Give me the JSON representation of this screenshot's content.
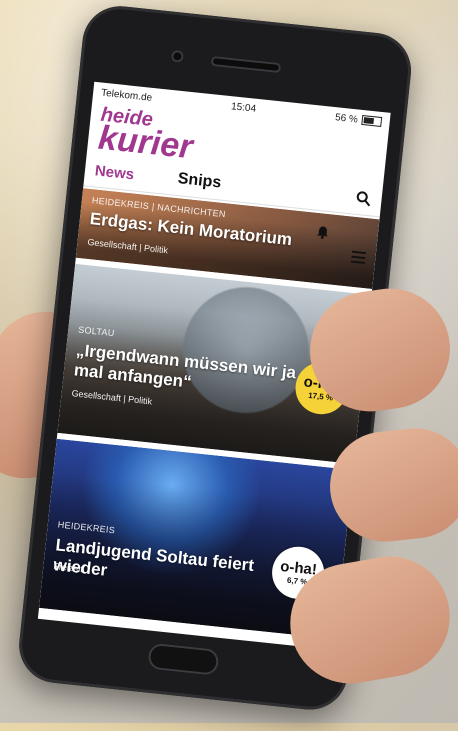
{
  "status_bar": {
    "carrier": "Telekom.de",
    "time": "15:04",
    "battery": "56 %"
  },
  "logo": {
    "line1": "heide",
    "line2": "kurier"
  },
  "nav": {
    "tab_news": "News",
    "tab_snips": "Snips",
    "search_icon": "search-icon"
  },
  "articles": [
    {
      "kicker": "HEIDEKREIS | NACHRICHTEN",
      "headline": "Erdgas: Kein Moratorium",
      "meta": "Gesellschaft | Politik"
    },
    {
      "kicker": "SOLTAU",
      "headline": "„Irgendwann müssen wir ja mal anfangen“",
      "meta": "Gesellschaft | Politik",
      "badge_main": "o-ha!",
      "badge_sub": "17,5 %"
    },
    {
      "kicker": "HEIDEKREIS",
      "headline": "Landjugend Soltau feiert wieder",
      "meta": "Freizeit",
      "badge_main": "o-ha!",
      "badge_sub": "6,7 %"
    }
  ],
  "colors": {
    "brand": "#a0388f",
    "badge_yellow": "#f6d239"
  }
}
